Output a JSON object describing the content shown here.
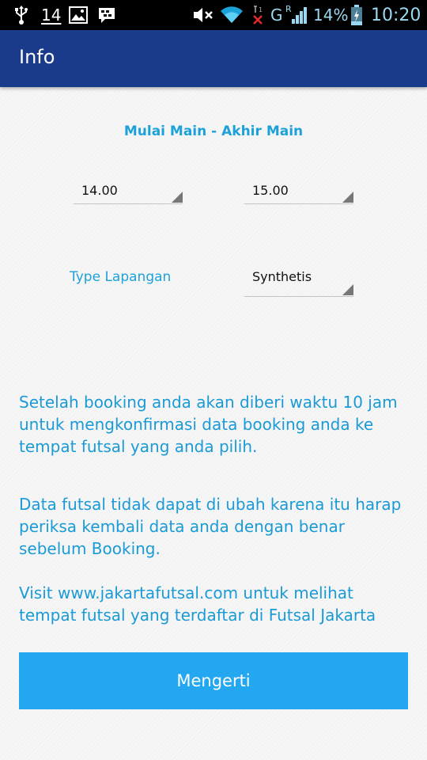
{
  "status_bar": {
    "notification_count": "14",
    "network_type": "G",
    "network_sub": "R",
    "battery": "14%",
    "time": "10:20",
    "icons": [
      "usb-icon",
      "image-icon",
      "bbm-icon",
      "mute-icon",
      "wifi-icon",
      "no-sim-icon",
      "signal-icon",
      "battery-icon"
    ]
  },
  "app_bar": {
    "title": "Info"
  },
  "booking": {
    "time_header": "Mulai Main - Akhir Main",
    "start_time": "14.00",
    "end_time": "15.00",
    "type_label": "Type Lapangan",
    "type_value": "Synthetis"
  },
  "info": {
    "paragraph_1": "Setelah booking anda akan diberi waktu 10 jam untuk mengkonfirmasi data booking anda ke tempat futsal yang anda pilih.",
    "paragraph_2": "Data futsal tidak dapat di ubah karena itu harap periksa kembali data anda dengan benar sebelum Booking.",
    "paragraph_3": "Visit www.jakartafutsal.com untuk melihat tempat futsal yang terdaftar di Futsal Jakarta"
  },
  "actions": {
    "confirm_label": "Mengerti"
  },
  "colors": {
    "app_bar": "#1a3a8c",
    "accent_text": "#1da1d9",
    "button": "#22a7f0"
  }
}
